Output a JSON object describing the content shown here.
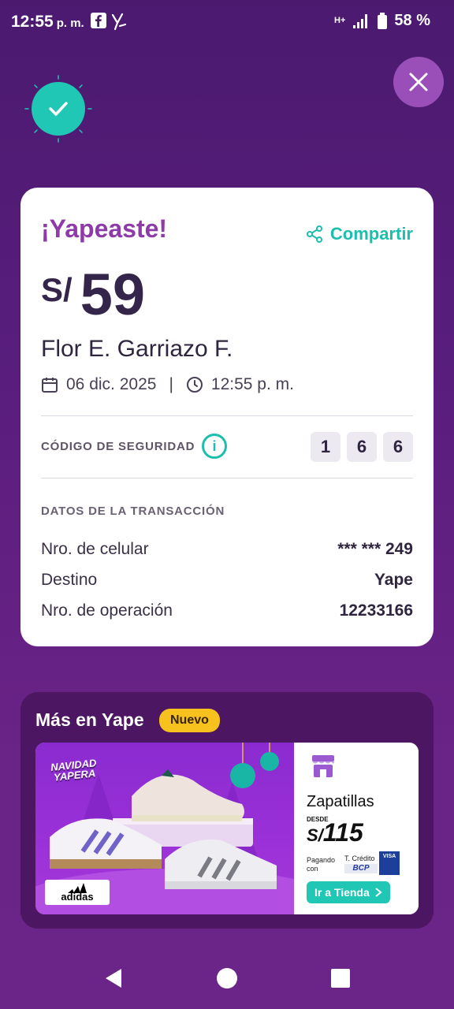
{
  "status_bar": {
    "time": "12:55",
    "ampm": "p. m.",
    "network": "H+",
    "battery": "58 %"
  },
  "receipt": {
    "title": "¡Yapeaste!",
    "share_label": "Compartir",
    "currency": "S/",
    "amount": "59",
    "recipient": "Flor E. Garriazo F.",
    "date": "06 dic. 2025",
    "time": "12:55 p. m.",
    "security_label": "CÓDIGO DE SEGURIDAD",
    "security_code": [
      "1",
      "6",
      "6"
    ],
    "transaction_title": "DATOS DE LA TRANSACCIÓN",
    "rows": [
      {
        "label": "Nro. de celular",
        "value": "*** *** 249"
      },
      {
        "label": "Destino",
        "value": "Yape"
      },
      {
        "label": "Nro. de operación",
        "value": "12233166"
      }
    ]
  },
  "promo": {
    "title": "Más en Yape",
    "badge": "Nuevo",
    "campaign": "NAVIDAD YAPERA",
    "brand": "adidas",
    "product": "Zapatillas",
    "desde": "DESDE",
    "price_currency": "S/",
    "price": "115",
    "pagando": "Pagando con",
    "card_label": "T. Crédito",
    "bank": "BCP",
    "card_brand": "VISA",
    "cta": "Ir a Tienda"
  },
  "colors": {
    "accent": "#20c7b5",
    "brand": "#8e3aa8",
    "background": "#5a1e7e",
    "badge": "#f7c21d"
  }
}
